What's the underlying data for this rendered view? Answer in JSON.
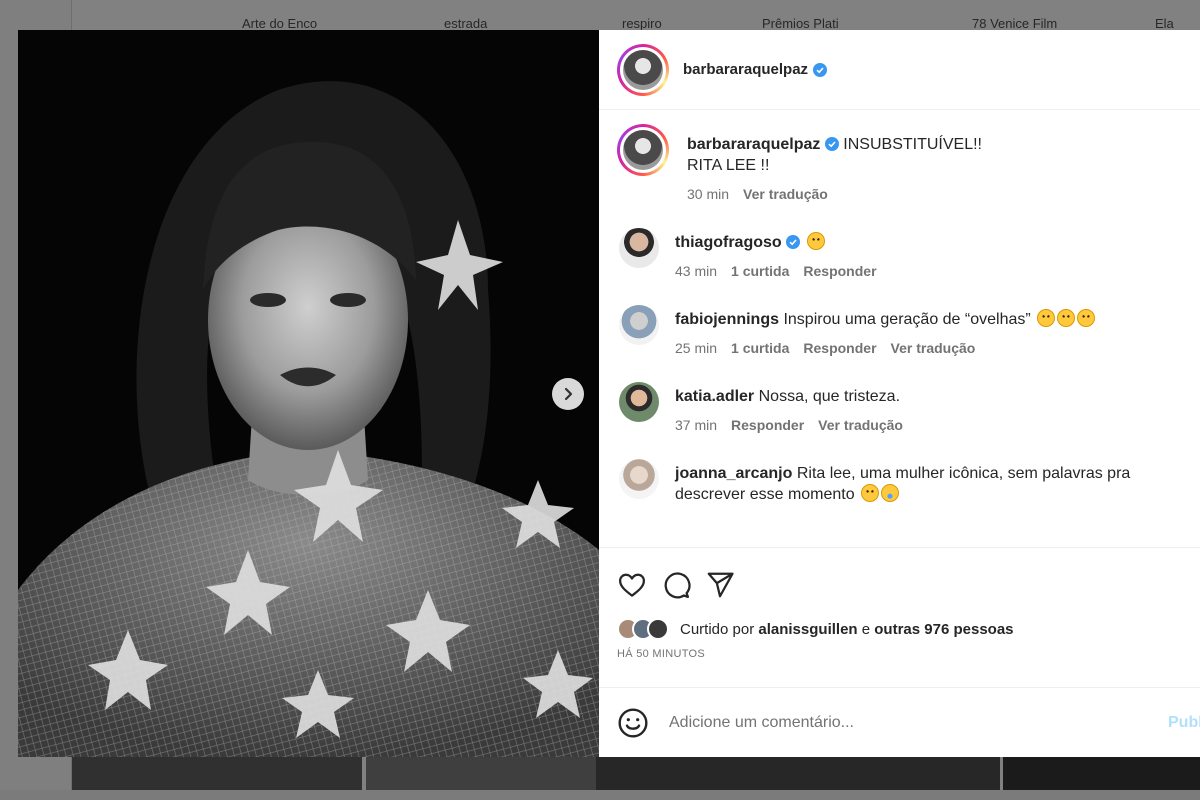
{
  "background": {
    "highlights": [
      "Arte do Enco",
      "estrada",
      "respiro",
      "Prêmios Plati",
      "78 Venice Film",
      "Ela"
    ]
  },
  "post": {
    "author": "barbararaquelpaz",
    "verified": true,
    "caption_line1": "INSUBSTITUÍVEL!!",
    "caption_line2": "RITA LEE !!",
    "caption_time": "30 min",
    "caption_translate": "Ver tradução"
  },
  "comments": [
    {
      "user": "thiagofragoso",
      "verified": true,
      "text": "",
      "emoji_count": 1,
      "time": "43 min",
      "likes": "1 curtida",
      "reply": "Responder",
      "translate": ""
    },
    {
      "user": "fabiojennings",
      "verified": false,
      "text": "Inspirou uma geração de “ovelhas”",
      "emoji_count": 3,
      "time": "25 min",
      "likes": "1 curtida",
      "reply": "Responder",
      "translate": "Ver tradução"
    },
    {
      "user": "katia.adler",
      "verified": false,
      "text": "Nossa, que tristeza.",
      "emoji_count": 0,
      "time": "37 min",
      "likes": "",
      "reply": "Responder",
      "translate": "Ver tradução"
    },
    {
      "user": "joanna_arcanjo",
      "verified": false,
      "text": "Rita lee, uma mulher icônica, sem palavras pra descrever esse momento",
      "emoji_count": 2,
      "time": "",
      "likes": "",
      "reply": "",
      "translate": ""
    }
  ],
  "likes_summary": {
    "prefix": "Curtido por",
    "user": "alanissguillen",
    "connector": "e",
    "others": "outras 976 pessoas"
  },
  "timestamp": "HÁ 50 MINUTOS",
  "comment_box": {
    "placeholder": "Adicione um comentário...",
    "publish_label": "Publicar"
  },
  "icons": {
    "like": "heart-icon",
    "comment": "comment-bubble-icon",
    "share": "paper-plane-icon",
    "emoji": "smiley-icon",
    "next": "chevron-right-icon",
    "verified": "verified-badge-icon"
  },
  "colors": {
    "verified_blue": "#3897f0",
    "publish_disabled": "#b2dffc",
    "muted_text": "#737373"
  }
}
